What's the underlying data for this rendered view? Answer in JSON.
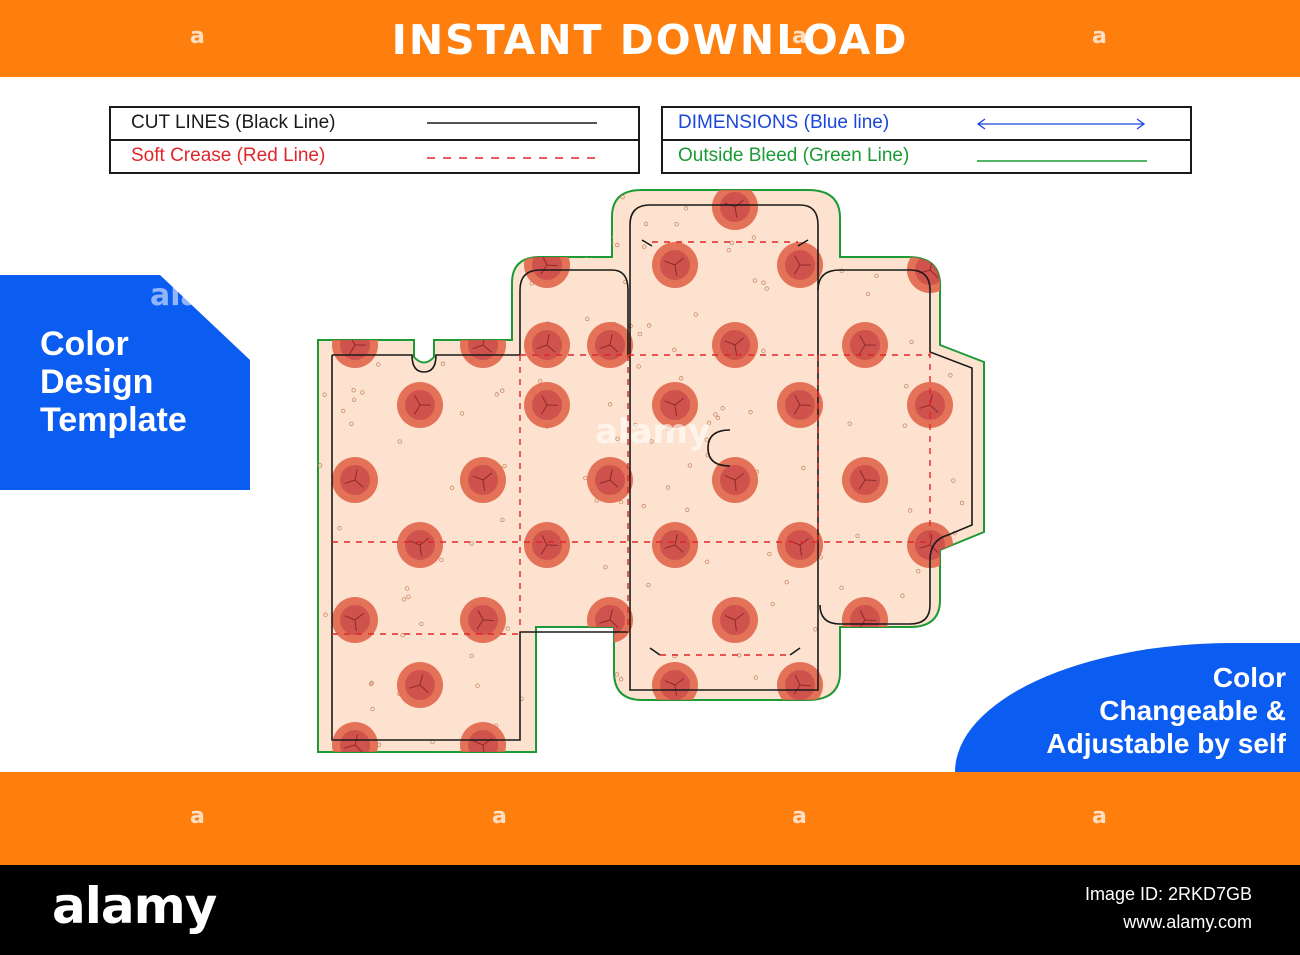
{
  "banner": {
    "title": "INSTANT DOWNLOAD"
  },
  "legend": {
    "cut_lines": "CUT LINES (Black Line)",
    "soft_crease": "Soft Crease (Red Line)",
    "dimensions": "DIMENSIONS (Blue line)",
    "outside_bleed": "Outside Bleed (Green Line)"
  },
  "left_badge": {
    "lines": [
      "Color",
      "Design",
      "Template"
    ]
  },
  "right_badge": {
    "lines": [
      "Color",
      "Changeable &",
      "Adjustable by self"
    ]
  },
  "footer": {
    "brand": "alamy",
    "image_id": "Image ID: 2RKD7GB",
    "site": "www.alamy.com"
  },
  "watermark": {
    "glyph": "a",
    "word": "alamy"
  },
  "colors": {
    "orange": "#ff7f0e",
    "blue": "#0b5cf0",
    "cut_line": "#1a1a1a",
    "crease_line": "#e0262a",
    "dimension_line": "#1a47d8",
    "bleed_line": "#1c9a35",
    "panel_fill": "#fde3cf",
    "dot_fill": "#e0654a"
  },
  "icons": {
    "box_dieline": "pizza-box-dieline-illustration"
  }
}
